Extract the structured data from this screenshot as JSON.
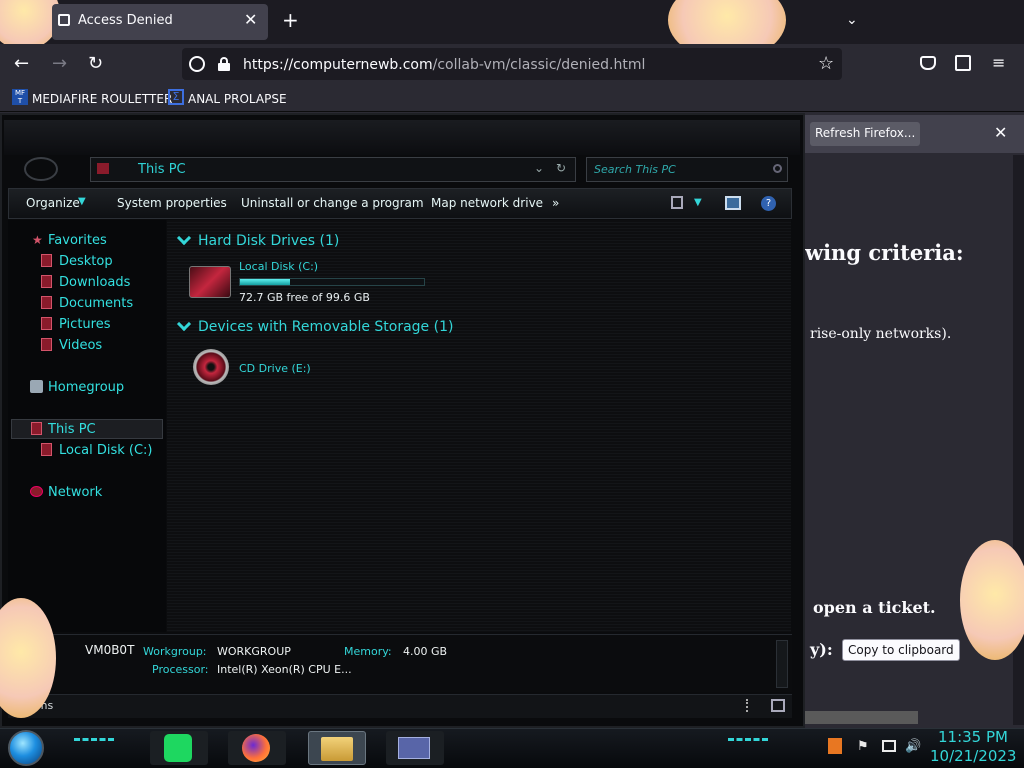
{
  "browser": {
    "tab": {
      "title": "Access Denied",
      "close_icon": "close-icon"
    },
    "new_tab_label": "+",
    "url": {
      "host": "https://computernewb.com",
      "path": "/collab-vm/classic/denied.html"
    },
    "bookmarks": [
      {
        "label": "MEDIAFIRE ROULETTER",
        "icon": "mediafire-icon"
      },
      {
        "label": "ANAL PROLAPSE",
        "icon": "sigma-icon"
      }
    ]
  },
  "page": {
    "notification_button": "Refresh Firefox...",
    "heading_fragment": "wing criteria:",
    "text_fragment": "rise-only networks).",
    "ticket_text": "open a ticket.",
    "label_fragment": "y):",
    "copy_button": "Copy to clipboard"
  },
  "explorer": {
    "address": "This PC",
    "search_placeholder": "Search This PC",
    "toolbar": {
      "organize": "Organize",
      "system_properties": "System properties",
      "uninstall": "Uninstall or change a program",
      "map_drive": "Map network drive",
      "more": "»"
    },
    "nav": {
      "favorites": "Favorites",
      "desktop": "Desktop",
      "downloads": "Downloads",
      "documents": "Documents",
      "pictures": "Pictures",
      "videos": "Videos",
      "homegroup": "Homegroup",
      "this_pc": "This PC",
      "local_disk": "Local Disk (C:)",
      "network": "Network"
    },
    "groups": {
      "hdd": "Hard Disk Drives (1)",
      "removable": "Devices with Removable Storage (1)"
    },
    "disk": {
      "label": "Local Disk (C:)",
      "free_text": "72.7 GB free of 99.6 GB",
      "used_fraction": 0.27
    },
    "cd": {
      "label": "CD Drive (E:)"
    },
    "details": {
      "computer_name": "VM0B0T",
      "workgroup_label": "Workgroup:",
      "workgroup_value": "WORKGROUP",
      "memory_label": "Memory:",
      "memory_value": "4.00 GB",
      "processor_label": "Processor:",
      "processor_value": "Intel(R) Xeon(R) CPU E..."
    },
    "status": "ems"
  },
  "taskbar": {
    "time": "11:35 PM",
    "date": "10/21/2023",
    "apps": [
      "notes-app-icon",
      "firefox-icon",
      "file-explorer-icon",
      "control-panel-icon"
    ]
  },
  "colors": {
    "accent": "#33d6d8",
    "explorer_bg": "#0a0b0d",
    "browser_bg": "#2b2a33"
  }
}
